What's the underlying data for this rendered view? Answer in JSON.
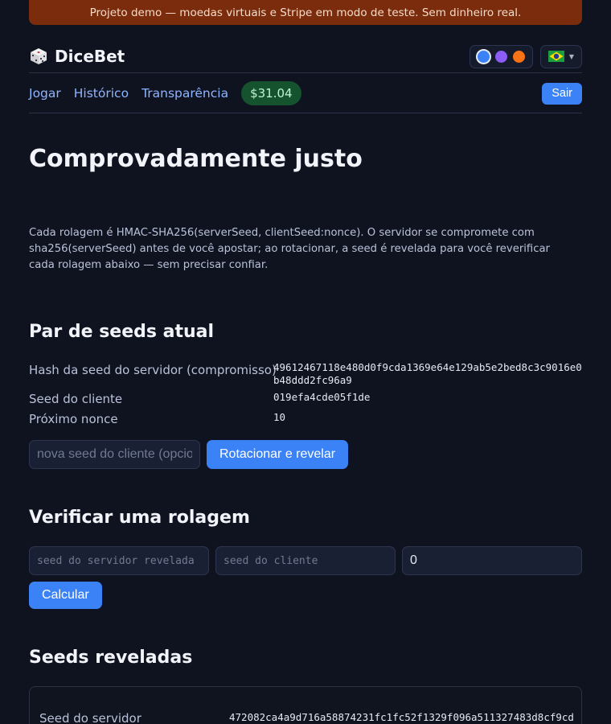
{
  "banner": {
    "text": "Projeto demo — moedas virtuais e Stripe em modo de teste. Sem dinheiro real."
  },
  "header": {
    "brand": "DiceBet",
    "theme_colors": [
      "#3b82f6",
      "#8b5cf6",
      "#f97316"
    ],
    "language_flag": "brazil-flag-icon"
  },
  "nav": {
    "links": [
      "Jogar",
      "Histórico",
      "Transparência"
    ],
    "balance": "$31.04",
    "logout_label": "Sair"
  },
  "page": {
    "title": "Comprovadamente justo",
    "intro": "Cada rolagem é HMAC-SHA256(serverSeed, clientSeed:nonce). O servidor se compromete com sha256(serverSeed) antes de você apostar; ao rotacionar, a seed é revelada para você reverificar cada rolagem abaixo — sem precisar confiar."
  },
  "current_pair": {
    "heading": "Par de seeds atual",
    "server_hash_label": "Hash da seed do servidor (compromisso)",
    "server_hash_value": "49612467118e480d0f9cda1369e64e129ab5e2bed8c3c9016e0b48ddd2fc96a9",
    "client_seed_label": "Seed do cliente",
    "client_seed_value": "019efa4cde05f1de",
    "nonce_label": "Próximo nonce",
    "nonce_value": "10",
    "new_seed_placeholder": "nova seed do cliente (opcional)",
    "rotate_label": "Rotacionar e revelar"
  },
  "verify": {
    "heading": "Verificar uma rolagem",
    "server_seed_placeholder": "seed do servidor revelada",
    "client_seed_placeholder": "seed do cliente",
    "nonce_value": "0",
    "calc_label": "Calcular"
  },
  "revealed": {
    "heading": "Seeds reveladas",
    "server_seed_label": "Seed do servidor",
    "server_seed_value": "472082ca4a9d716a58874231fc1fc52f1329f096a511327483d8cf9cd"
  }
}
